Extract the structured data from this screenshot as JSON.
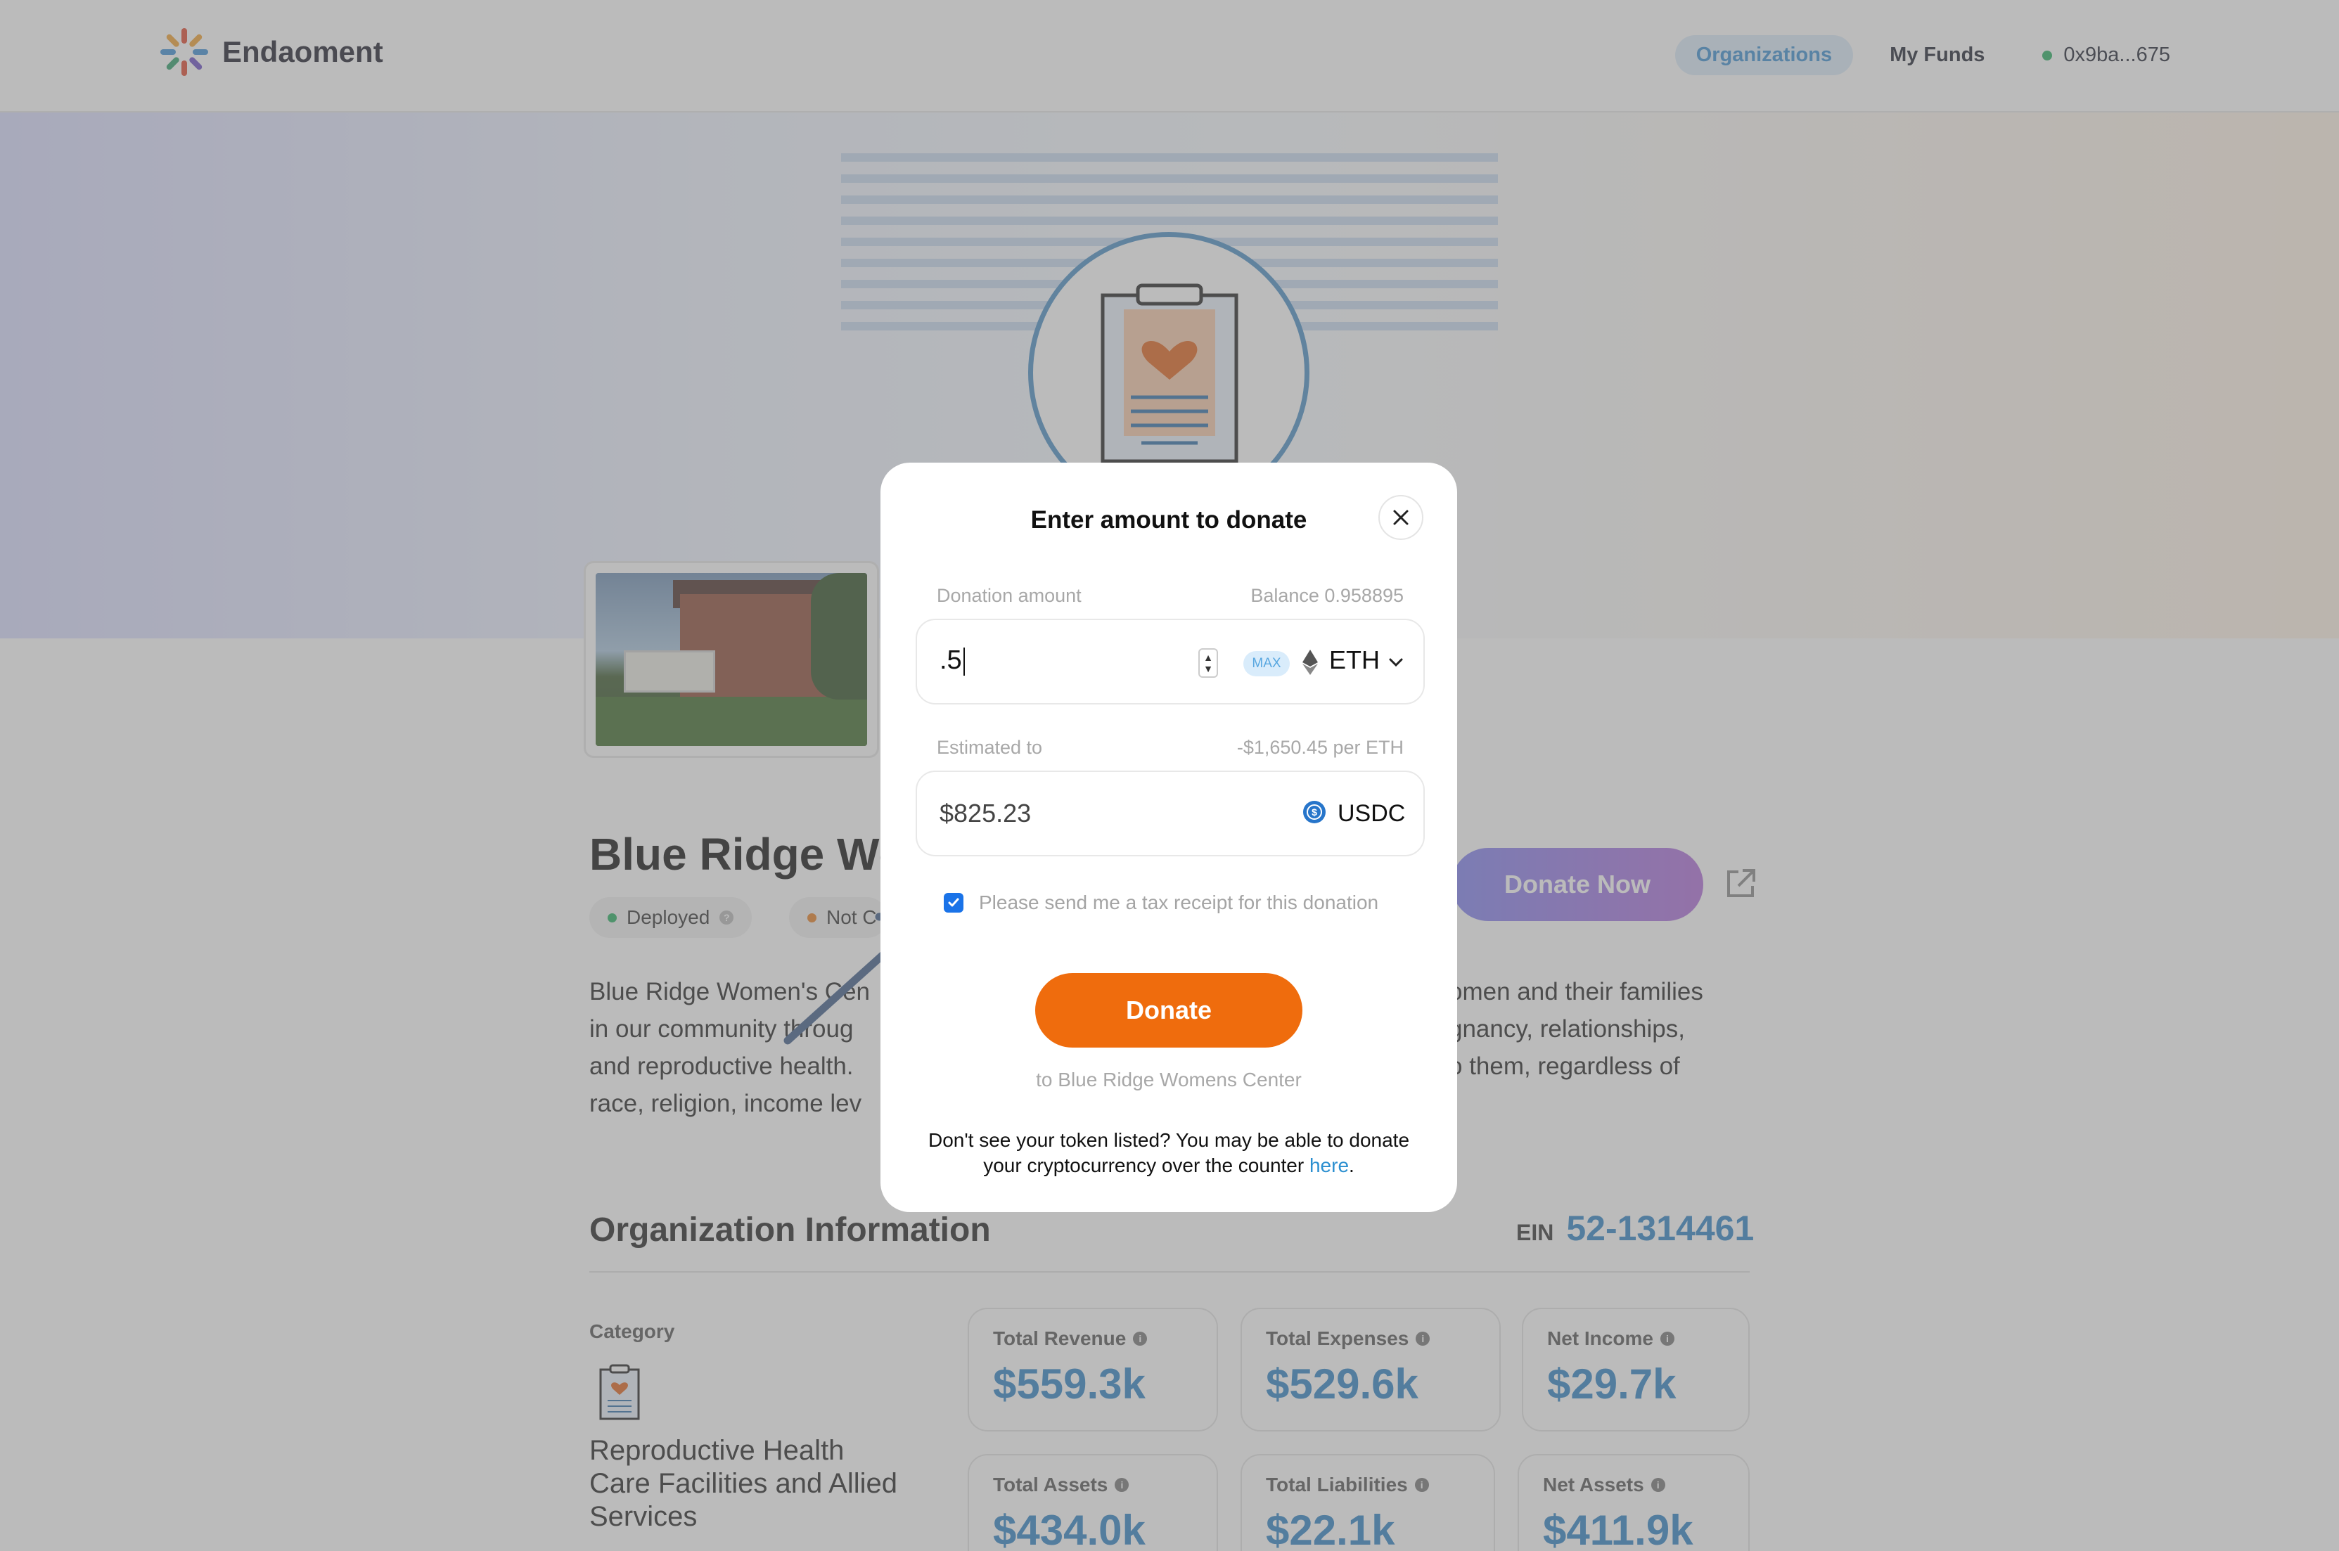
{
  "header": {
    "brand": "Endaoment",
    "nav": [
      {
        "label": "Organizations",
        "active": true
      },
      {
        "label": "My Funds",
        "active": false
      }
    ],
    "wallet": "0x9ba...675"
  },
  "org": {
    "title": "Blue Ridge Women's Center",
    "chips": [
      {
        "label": "Deployed",
        "color": "#27ae60"
      },
      {
        "label": "Not C",
        "color": "#e67e22"
      }
    ],
    "description_left": [
      "Blue Ridge Women's Cen",
      "in our community throug",
      "and reproductive health.",
      "race, religion, income lev"
    ],
    "description_right": [
      "omen and their families",
      "gnancy, relationships,",
      "o them, regardless of",
      ""
    ],
    "donate_now_label": "Donate Now"
  },
  "info": {
    "heading": "Organization Information",
    "ein_label": "EIN",
    "ein_value": "52-1314461",
    "category_label": "Category",
    "category_text": "Reproductive Health Care Facilities and Allied Services",
    "stats": [
      {
        "label": "Total Revenue",
        "value": "$559.3k"
      },
      {
        "label": "Total Expenses",
        "value": "$529.6k"
      },
      {
        "label": "Net Income",
        "value": "$29.7k"
      },
      {
        "label": "Total Assets",
        "value": "$434.0k"
      },
      {
        "label": "Total Liabilities",
        "value": "$22.1k"
      },
      {
        "label": "Net Assets",
        "value": "$411.9k"
      }
    ]
  },
  "modal": {
    "title": "Enter amount to donate",
    "donation_amount_label": "Donation amount",
    "balance_label": "Balance 0.958895",
    "amount_value": ".5",
    "max_label": "MAX",
    "token": "ETH",
    "estimated_label": "Estimated to",
    "rate_label": "-$1,650.45 per ETH",
    "estimated_value": "$825.23",
    "estimated_token": "USDC",
    "tax_receipt_checked": true,
    "tax_receipt_label": "Please send me a tax receipt for this donation",
    "donate_label": "Donate",
    "to_label": "to Blue Ridge Womens Center",
    "footer_text": "Don't see your token listed? You may be able to donate your cryptocurrency over the counter",
    "footer_link": "here",
    "footer_end": "."
  },
  "colors": {
    "accent": "#2f82c4",
    "donate_orange": "#ef6c0d",
    "checkbox_blue": "#1a73e8",
    "overlay": "rgba(120,120,120,0.5)"
  },
  "icons": [
    "logo-mark-icon",
    "clipboard-heart-icon",
    "external-link-icon",
    "close-icon",
    "eth-icon",
    "chevron-down-icon",
    "usdc-icon",
    "info-icon",
    "arrow-annotation-icon"
  ]
}
